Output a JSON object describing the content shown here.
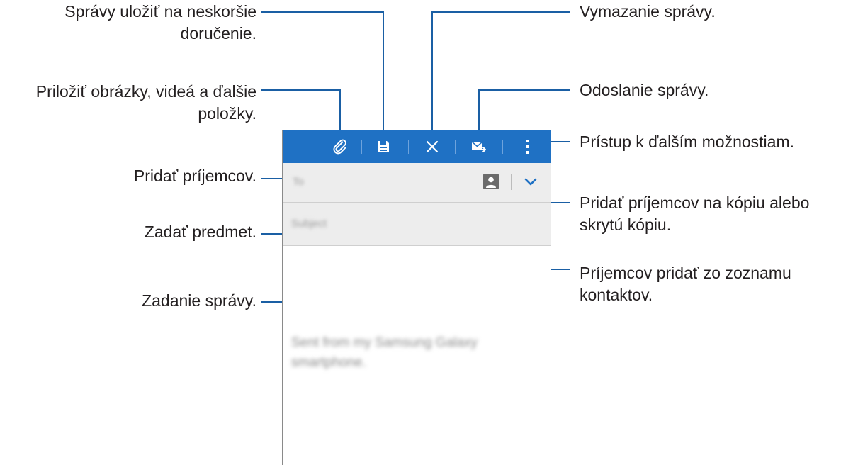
{
  "callouts": {
    "save": [
      "Správy uložiť na neskoršie",
      "doručenie."
    ],
    "attach": [
      "Priložiť obrázky, videá a ďalšie",
      "položky."
    ],
    "add_recipients": "Pridať príjemcov.",
    "subject": "Zadať predmet.",
    "compose": "Zadanie správy.",
    "delete": "Vymazanie správy.",
    "send": "Odoslanie správy.",
    "more": "Prístup k ďalším možnostiam.",
    "cc_bcc": [
      "Pridať príjemcov na kópiu alebo",
      "skrytú kópiu."
    ],
    "contacts": [
      "Príjemcov pridať zo zoznamu",
      "kontaktov."
    ]
  },
  "phone": {
    "to_placeholder": "To",
    "subject_placeholder": "Subject",
    "body_text": "Sent from my Samsung Galaxy smartphone."
  },
  "icons": {
    "attach": "paperclip-icon",
    "save": "floppy-disk-icon",
    "delete": "close-icon",
    "send": "send-mail-icon",
    "more": "more-vertical-icon",
    "contacts": "contact-card-icon",
    "expand": "chevron-down-icon"
  },
  "colors": {
    "action_bar": "#1f71c4",
    "callout_line": "#1a5fa4",
    "field_background": "#ededed"
  }
}
